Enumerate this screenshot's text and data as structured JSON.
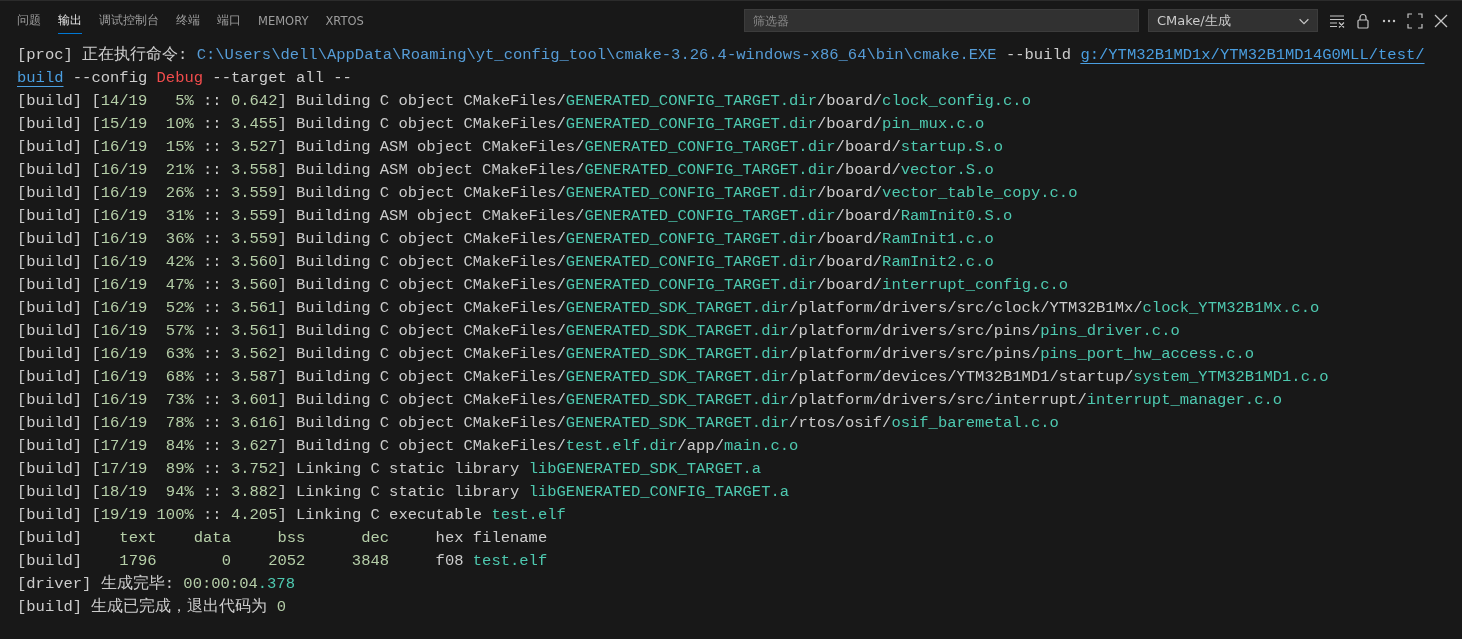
{
  "tabs": [
    {
      "label": "问题",
      "selected": false
    },
    {
      "label": "输出",
      "selected": true
    },
    {
      "label": "调试控制台",
      "selected": false
    },
    {
      "label": "终端",
      "selected": false
    },
    {
      "label": "端口",
      "selected": false
    },
    {
      "label": "MEMORY",
      "selected": false
    },
    {
      "label": "XRTOS",
      "selected": false
    }
  ],
  "filter": {
    "placeholder": "筛选器"
  },
  "channel_select": {
    "value": "CMake/生成"
  },
  "output": {
    "lines": [
      {
        "segments": [
          {
            "kind": "plain",
            "text": "[proc] 正在执行命令: "
          },
          {
            "kind": "command",
            "text": "C:\\Users\\dell\\AppData\\Roaming\\yt_config_tool\\cmake-3.26.4-windows-x86_64\\bin\\cmake.EXE"
          },
          {
            "kind": "plain",
            "text": " --build "
          },
          {
            "kind": "link",
            "text": "g:/YTM32B1MD1x/YTM32B1MD14G0MLL/test/"
          }
        ]
      },
      {
        "segments": [
          {
            "kind": "link",
            "text": "build"
          },
          {
            "kind": "plain",
            "text": " --config "
          },
          {
            "kind": "error",
            "text": "Debug"
          },
          {
            "kind": "plain",
            "text": " --target all --"
          }
        ]
      },
      {
        "segments": [
          {
            "kind": "plain",
            "text": "[build] ["
          },
          {
            "kind": "number",
            "text": "14/19   5%"
          },
          {
            "kind": "plain",
            "text": " :: "
          },
          {
            "kind": "number",
            "text": "0.642"
          },
          {
            "kind": "plain",
            "text": "] Building C object CMakeFiles/"
          },
          {
            "kind": "file",
            "text": "GENERATED_CONFIG_TARGET.dir"
          },
          {
            "kind": "plain",
            "text": "/board/"
          },
          {
            "kind": "file",
            "text": "clock_config.c.o"
          }
        ]
      },
      {
        "segments": [
          {
            "kind": "plain",
            "text": "[build] ["
          },
          {
            "kind": "number",
            "text": "15/19  10%"
          },
          {
            "kind": "plain",
            "text": " :: "
          },
          {
            "kind": "number",
            "text": "3.455"
          },
          {
            "kind": "plain",
            "text": "] Building C object CMakeFiles/"
          },
          {
            "kind": "file",
            "text": "GENERATED_CONFIG_TARGET.dir"
          },
          {
            "kind": "plain",
            "text": "/board/"
          },
          {
            "kind": "file",
            "text": "pin_mux.c.o"
          }
        ]
      },
      {
        "segments": [
          {
            "kind": "plain",
            "text": "[build] ["
          },
          {
            "kind": "number",
            "text": "16/19  15%"
          },
          {
            "kind": "plain",
            "text": " :: "
          },
          {
            "kind": "number",
            "text": "3.527"
          },
          {
            "kind": "plain",
            "text": "] Building ASM object CMakeFiles/"
          },
          {
            "kind": "file",
            "text": "GENERATED_CONFIG_TARGET.dir"
          },
          {
            "kind": "plain",
            "text": "/board/"
          },
          {
            "kind": "file",
            "text": "startup.S.o"
          }
        ]
      },
      {
        "segments": [
          {
            "kind": "plain",
            "text": "[build] ["
          },
          {
            "kind": "number",
            "text": "16/19  21%"
          },
          {
            "kind": "plain",
            "text": " :: "
          },
          {
            "kind": "number",
            "text": "3.558"
          },
          {
            "kind": "plain",
            "text": "] Building ASM object CMakeFiles/"
          },
          {
            "kind": "file",
            "text": "GENERATED_CONFIG_TARGET.dir"
          },
          {
            "kind": "plain",
            "text": "/board/"
          },
          {
            "kind": "file",
            "text": "vector.S.o"
          }
        ]
      },
      {
        "segments": [
          {
            "kind": "plain",
            "text": "[build] ["
          },
          {
            "kind": "number",
            "text": "16/19  26%"
          },
          {
            "kind": "plain",
            "text": " :: "
          },
          {
            "kind": "number",
            "text": "3.559"
          },
          {
            "kind": "plain",
            "text": "] Building C object CMakeFiles/"
          },
          {
            "kind": "file",
            "text": "GENERATED_CONFIG_TARGET.dir"
          },
          {
            "kind": "plain",
            "text": "/board/"
          },
          {
            "kind": "file",
            "text": "vector_table_copy.c.o"
          }
        ]
      },
      {
        "segments": [
          {
            "kind": "plain",
            "text": "[build] ["
          },
          {
            "kind": "number",
            "text": "16/19  31%"
          },
          {
            "kind": "plain",
            "text": " :: "
          },
          {
            "kind": "number",
            "text": "3.559"
          },
          {
            "kind": "plain",
            "text": "] Building ASM object CMakeFiles/"
          },
          {
            "kind": "file",
            "text": "GENERATED_CONFIG_TARGET.dir"
          },
          {
            "kind": "plain",
            "text": "/board/"
          },
          {
            "kind": "file",
            "text": "RamInit0.S.o"
          }
        ]
      },
      {
        "segments": [
          {
            "kind": "plain",
            "text": "[build] ["
          },
          {
            "kind": "number",
            "text": "16/19  36%"
          },
          {
            "kind": "plain",
            "text": " :: "
          },
          {
            "kind": "number",
            "text": "3.559"
          },
          {
            "kind": "plain",
            "text": "] Building C object CMakeFiles/"
          },
          {
            "kind": "file",
            "text": "GENERATED_CONFIG_TARGET.dir"
          },
          {
            "kind": "plain",
            "text": "/board/"
          },
          {
            "kind": "file",
            "text": "RamInit1.c.o"
          }
        ]
      },
      {
        "segments": [
          {
            "kind": "plain",
            "text": "[build] ["
          },
          {
            "kind": "number",
            "text": "16/19  42%"
          },
          {
            "kind": "plain",
            "text": " :: "
          },
          {
            "kind": "number",
            "text": "3.560"
          },
          {
            "kind": "plain",
            "text": "] Building C object CMakeFiles/"
          },
          {
            "kind": "file",
            "text": "GENERATED_CONFIG_TARGET.dir"
          },
          {
            "kind": "plain",
            "text": "/board/"
          },
          {
            "kind": "file",
            "text": "RamInit2.c.o"
          }
        ]
      },
      {
        "segments": [
          {
            "kind": "plain",
            "text": "[build] ["
          },
          {
            "kind": "number",
            "text": "16/19  47%"
          },
          {
            "kind": "plain",
            "text": " :: "
          },
          {
            "kind": "number",
            "text": "3.560"
          },
          {
            "kind": "plain",
            "text": "] Building C object CMakeFiles/"
          },
          {
            "kind": "file",
            "text": "GENERATED_CONFIG_TARGET.dir"
          },
          {
            "kind": "plain",
            "text": "/board/"
          },
          {
            "kind": "file",
            "text": "interrupt_config.c.o"
          }
        ]
      },
      {
        "segments": [
          {
            "kind": "plain",
            "text": "[build] ["
          },
          {
            "kind": "number",
            "text": "16/19  52%"
          },
          {
            "kind": "plain",
            "text": " :: "
          },
          {
            "kind": "number",
            "text": "3.561"
          },
          {
            "kind": "plain",
            "text": "] Building C object CMakeFiles/"
          },
          {
            "kind": "file",
            "text": "GENERATED_SDK_TARGET.dir"
          },
          {
            "kind": "plain",
            "text": "/platform/drivers/src/clock/YTM32B1Mx/"
          },
          {
            "kind": "file",
            "text": "clock_YTM32B1Mx.c.o"
          }
        ]
      },
      {
        "segments": [
          {
            "kind": "plain",
            "text": "[build] ["
          },
          {
            "kind": "number",
            "text": "16/19  57%"
          },
          {
            "kind": "plain",
            "text": " :: "
          },
          {
            "kind": "number",
            "text": "3.561"
          },
          {
            "kind": "plain",
            "text": "] Building C object CMakeFiles/"
          },
          {
            "kind": "file",
            "text": "GENERATED_SDK_TARGET.dir"
          },
          {
            "kind": "plain",
            "text": "/platform/drivers/src/pins/"
          },
          {
            "kind": "file",
            "text": "pins_driver.c.o"
          }
        ]
      },
      {
        "segments": [
          {
            "kind": "plain",
            "text": "[build] ["
          },
          {
            "kind": "number",
            "text": "16/19  63%"
          },
          {
            "kind": "plain",
            "text": " :: "
          },
          {
            "kind": "number",
            "text": "3.562"
          },
          {
            "kind": "plain",
            "text": "] Building C object CMakeFiles/"
          },
          {
            "kind": "file",
            "text": "GENERATED_SDK_TARGET.dir"
          },
          {
            "kind": "plain",
            "text": "/platform/drivers/src/pins/"
          },
          {
            "kind": "file",
            "text": "pins_port_hw_access.c.o"
          }
        ]
      },
      {
        "segments": [
          {
            "kind": "plain",
            "text": "[build] ["
          },
          {
            "kind": "number",
            "text": "16/19  68%"
          },
          {
            "kind": "plain",
            "text": " :: "
          },
          {
            "kind": "number",
            "text": "3.587"
          },
          {
            "kind": "plain",
            "text": "] Building C object CMakeFiles/"
          },
          {
            "kind": "file",
            "text": "GENERATED_SDK_TARGET.dir"
          },
          {
            "kind": "plain",
            "text": "/platform/devices/YTM32B1MD1/startup/"
          },
          {
            "kind": "file",
            "text": "system_YTM32B1MD1.c.o"
          }
        ]
      },
      {
        "segments": [
          {
            "kind": "plain",
            "text": "[build] ["
          },
          {
            "kind": "number",
            "text": "16/19  73%"
          },
          {
            "kind": "plain",
            "text": " :: "
          },
          {
            "kind": "number",
            "text": "3.601"
          },
          {
            "kind": "plain",
            "text": "] Building C object CMakeFiles/"
          },
          {
            "kind": "file",
            "text": "GENERATED_SDK_TARGET.dir"
          },
          {
            "kind": "plain",
            "text": "/platform/drivers/src/interrupt/"
          },
          {
            "kind": "file",
            "text": "interrupt_manager.c.o"
          }
        ]
      },
      {
        "segments": [
          {
            "kind": "plain",
            "text": "[build] ["
          },
          {
            "kind": "number",
            "text": "16/19  78%"
          },
          {
            "kind": "plain",
            "text": " :: "
          },
          {
            "kind": "number",
            "text": "3.616"
          },
          {
            "kind": "plain",
            "text": "] Building C object CMakeFiles/"
          },
          {
            "kind": "file",
            "text": "GENERATED_SDK_TARGET.dir"
          },
          {
            "kind": "plain",
            "text": "/rtos/osif/"
          },
          {
            "kind": "file",
            "text": "osif_baremetal.c.o"
          }
        ]
      },
      {
        "segments": [
          {
            "kind": "plain",
            "text": "[build] ["
          },
          {
            "kind": "number",
            "text": "17/19  84%"
          },
          {
            "kind": "plain",
            "text": " :: "
          },
          {
            "kind": "number",
            "text": "3.627"
          },
          {
            "kind": "plain",
            "text": "] Building C object CMakeFiles/"
          },
          {
            "kind": "file",
            "text": "test.elf.dir"
          },
          {
            "kind": "plain",
            "text": "/app/"
          },
          {
            "kind": "file",
            "text": "main.c.o"
          }
        ]
      },
      {
        "segments": [
          {
            "kind": "plain",
            "text": "[build] ["
          },
          {
            "kind": "number",
            "text": "17/19  89%"
          },
          {
            "kind": "plain",
            "text": " :: "
          },
          {
            "kind": "number",
            "text": "3.752"
          },
          {
            "kind": "plain",
            "text": "] Linking C static library "
          },
          {
            "kind": "file",
            "text": "libGENERATED_SDK_TARGET.a"
          }
        ]
      },
      {
        "segments": [
          {
            "kind": "plain",
            "text": "[build] ["
          },
          {
            "kind": "number",
            "text": "18/19  94%"
          },
          {
            "kind": "plain",
            "text": " :: "
          },
          {
            "kind": "number",
            "text": "3.882"
          },
          {
            "kind": "plain",
            "text": "] Linking C static library "
          },
          {
            "kind": "file",
            "text": "libGENERATED_CONFIG_TARGET.a"
          }
        ]
      },
      {
        "segments": [
          {
            "kind": "plain",
            "text": "[build] ["
          },
          {
            "kind": "number",
            "text": "19/19 100%"
          },
          {
            "kind": "plain",
            "text": " :: "
          },
          {
            "kind": "number",
            "text": "4.205"
          },
          {
            "kind": "plain",
            "text": "] Linking C executable "
          },
          {
            "kind": "file",
            "text": "test.elf"
          }
        ]
      },
      {
        "segments": [
          {
            "kind": "plain",
            "text": "[build]    "
          },
          {
            "kind": "number",
            "text": "text    data     bss      dec"
          },
          {
            "kind": "plain",
            "text": "     hex filename"
          }
        ]
      },
      {
        "segments": [
          {
            "kind": "plain",
            "text": "[build]    "
          },
          {
            "kind": "number",
            "text": "1796       0    2052     3848"
          },
          {
            "kind": "plain",
            "text": "     f08 "
          },
          {
            "kind": "file",
            "text": "test.elf"
          }
        ]
      },
      {
        "segments": [
          {
            "kind": "plain",
            "text": "[driver] 生成完毕: "
          },
          {
            "kind": "number",
            "text": "00:00:04"
          },
          {
            "kind": "file",
            "text": ".378"
          }
        ]
      },
      {
        "segments": [
          {
            "kind": "plain",
            "text": "[build] 生成已完成，退出代码为 "
          },
          {
            "kind": "number",
            "text": "0"
          }
        ]
      }
    ]
  }
}
